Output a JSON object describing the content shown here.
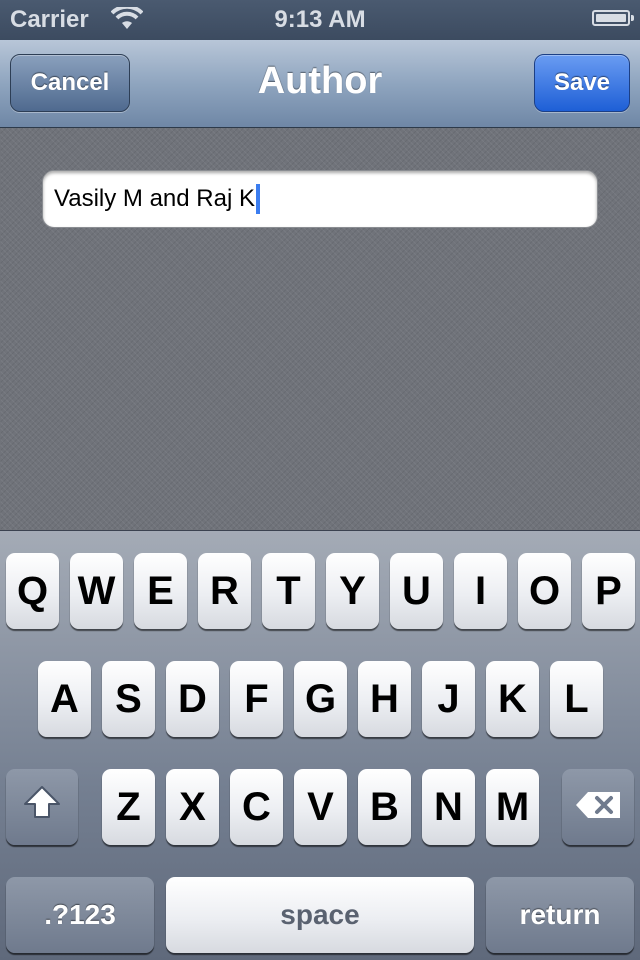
{
  "status_bar": {
    "carrier": "Carrier",
    "time": "9:13 AM",
    "wifi_icon": "wifi-icon",
    "battery_icon": "battery-full-icon"
  },
  "nav": {
    "title": "Author",
    "cancel_label": "Cancel",
    "save_label": "Save"
  },
  "author_field": {
    "value": "Vasily M and Raj K"
  },
  "keyboard": {
    "row1": [
      "Q",
      "W",
      "E",
      "R",
      "T",
      "Y",
      "U",
      "I",
      "O",
      "P"
    ],
    "row2": [
      "A",
      "S",
      "D",
      "F",
      "G",
      "H",
      "J",
      "K",
      "L"
    ],
    "row3": [
      "Z",
      "X",
      "C",
      "V",
      "B",
      "N",
      "M"
    ],
    "shift_icon": "shift-icon",
    "delete_icon": "backspace-icon",
    "numbers_label": ".?123",
    "space_label": "space",
    "return_label": "return"
  },
  "colors": {
    "save_button": "#2f6fe0",
    "nav_bar": "#8fa5bf",
    "cursor": "#3b7df0"
  }
}
